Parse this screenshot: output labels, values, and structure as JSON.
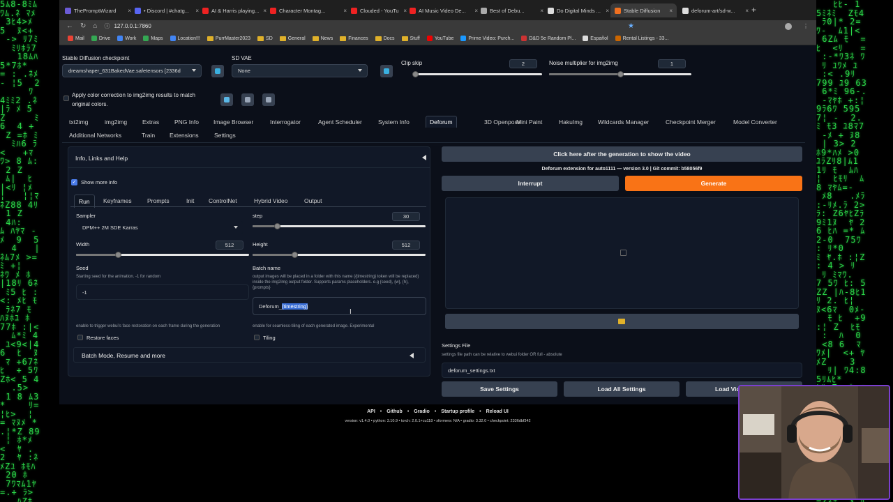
{
  "browser": {
    "tabs": [
      {
        "label": "ThePromptWizard",
        "color": "#6b5bd6"
      },
      {
        "label": "• Discord | #chatg...",
        "color": "#5865f2"
      },
      {
        "label": "AI & Harris playing...",
        "color": "#e22"
      },
      {
        "label": "Character Montag...",
        "color": "#e22"
      },
      {
        "label": "Clouded - YouTube",
        "color": "#e22"
      },
      {
        "label": "AI Music Video De...",
        "color": "#e22"
      },
      {
        "label": "Best of Debu...",
        "color": "#aaa"
      },
      {
        "label": "Do Digital Minds ...",
        "color": "#ddd"
      },
      {
        "label": "Stable Diffusion",
        "color": "#f07020"
      },
      {
        "label": "deforum-art/sd-w...",
        "color": "#ddd"
      }
    ],
    "url": "127.0.0.1:7860",
    "bookmarks": [
      "Mail",
      "Drive",
      "Work",
      "Maps",
      "Location!!!",
      "PurrMaster2023",
      "SD",
      "General",
      "News",
      "Finances",
      "Docs",
      "Stuff",
      "YouTube",
      "Prime Video: Purch...",
      "D&D 5e Random Pl...",
      "Español",
      "Rental Listings - 33..."
    ]
  },
  "top": {
    "checkpoint_label": "Stable Diffusion checkpoint",
    "checkpoint_value": "dreamshaper_631BakedVae.safetensors [2336d",
    "vae_label": "SD VAE",
    "vae_value": "None",
    "clip_label": "Clip skip",
    "clip_value": "2",
    "clip_fraction": 0.0,
    "noise_label": "Noise multiplier for img2img",
    "noise_value": "1",
    "noise_fraction": 0.5,
    "color_correction": "Apply color correction to img2img results to match original colors."
  },
  "main_tabs": [
    "txt2img",
    "img2img",
    "Extras",
    "PNG Info",
    "Image Browser",
    "Interrogator",
    "Agent Scheduler",
    "System Info",
    "Deforum",
    "3D Openpose",
    "Mini Paint",
    "HakuImg",
    "Wildcards Manager",
    "Checkpoint Merger",
    "Model Converter"
  ],
  "main_tabs_row2": [
    "Additional Networks",
    "Train",
    "Extensions",
    "Settings"
  ],
  "deforum": {
    "info_header": "Info, Links and Help",
    "show_more": "Show more info",
    "subtabs": [
      "Run",
      "Keyframes",
      "Prompts",
      "Init",
      "ControlNet",
      "Hybrid Video",
      "Output"
    ],
    "sampler_label": "Sampler",
    "sampler_value": "DPM++ 2M SDE Karras",
    "steps_label": "step",
    "steps_value": "30",
    "steps_fraction": 0.14,
    "width_label": "Width",
    "width_value": "512",
    "width_fraction": 0.24,
    "height_label": "Height",
    "height_value": "512",
    "height_fraction": 0.24,
    "seed_label": "Seed",
    "seed_help": "Starting seed for the animation. -1 for random",
    "seed_value": "-1",
    "batch_label": "Batch name",
    "batch_help": "output images will be placed in a folder with this name ({timestring} token will be replaced) inside the img2img output folder. Supports params placeholders. e.g {seed}, {w}, {h}, {prompts}",
    "batch_prefix": "Deforum_",
    "batch_token": "{timestring}",
    "restore_help": "enable to trigger webui's face restoration on each frame during the generation",
    "restore_label": "Restore faces",
    "tiling_help": "enable for seamless-tiling of each generated image. Experimental",
    "tiling_label": "Tiling",
    "batch_mode": "Batch Mode, Resume and more",
    "video_btn": "Click here after the generation to show the video",
    "version_line": "Deforum extension for auto1111 — version 3.0 | Git commit: b58056f9",
    "interrupt": "Interrupt",
    "generate": "Generate",
    "settings_file_label": "Settings File",
    "settings_file_help": "settings file path can be relative to webui folder OR full - absolute",
    "settings_file_value": "deforum_settings.txt",
    "save_settings": "Save Settings",
    "load_all": "Load All Settings",
    "load_video": "Load Vid"
  },
  "footer": {
    "links": [
      "API",
      "Github",
      "Gradio",
      "Startup profile",
      "Reload UI"
    ],
    "version": "version: v1.4.0  •  python: 3.10.9  •  torch: 2.0.1+cu118  •  xformers: N/A  •  gradio: 3.32.0  •  checkpoint: 2336dbf342"
  },
  "colors": {
    "generate": "#f97316",
    "bg": "#0b0f19",
    "panel": "#111827",
    "matrix": "#2bd84a",
    "webcam_border": "#7b3fd0"
  }
}
